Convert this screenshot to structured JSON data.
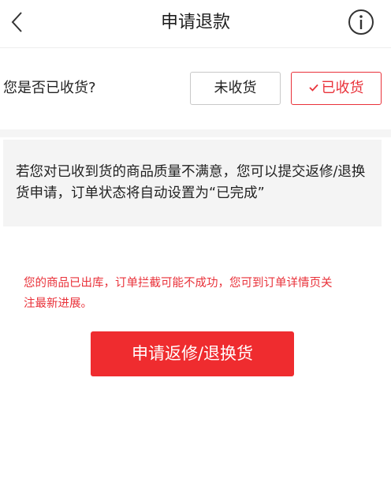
{
  "header": {
    "title": "申请退款",
    "back_icon": "chevron-left-icon",
    "info_icon": "info-circle-icon"
  },
  "received": {
    "question": "您是否已收货?",
    "options": [
      {
        "label": "未收货",
        "selected": false
      },
      {
        "label": "已收货",
        "selected": true
      }
    ]
  },
  "notice": {
    "text": "若您对已收到货的商品质量不满意，您可以提交返修/退换货申请，订单状态将自动设置为“已完成”"
  },
  "warning": {
    "text": "您的商品已出库，订单拦截可能不成功，您可到订单详情页关注最新进展。"
  },
  "actions": {
    "apply_label": "申请返修/退换货"
  },
  "colors": {
    "accent": "#e9323a",
    "button_bg": "#ef2c2f",
    "notice_bg": "#f4f4f4"
  }
}
